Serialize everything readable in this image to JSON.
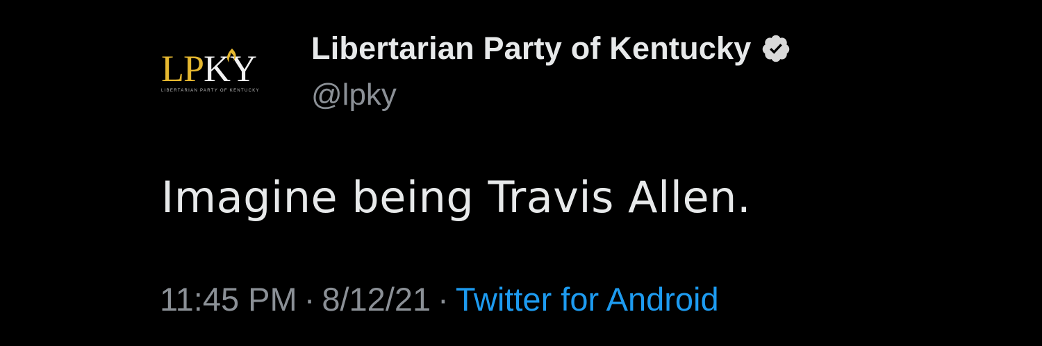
{
  "tweet": {
    "author": {
      "display_name": "Libertarian Party of Kentucky",
      "handle": "@lpky",
      "verified": true,
      "avatar": {
        "logo_text_lp": "LP",
        "logo_text_k": "K",
        "logo_text_y": "Y",
        "logo_subtitle": "LIBERTARIAN PARTY OF KENTUCKY",
        "logo_color_lp": "#e6b830",
        "logo_color_ky": "#f2f2f2"
      }
    },
    "text": "Imagine being Travis Allen.",
    "meta": {
      "time": "11:45 PM",
      "separator": "·",
      "date": "8/12/21",
      "source": "Twitter for Android"
    }
  },
  "colors": {
    "background": "#000000",
    "primary_text": "#e7e9ea",
    "secondary_text": "#8b9096",
    "link": "#1d9bf0",
    "verified_badge": "#d9d9d9"
  },
  "icons": {
    "verified": "verified-badge-icon",
    "torch": "torch-icon"
  }
}
